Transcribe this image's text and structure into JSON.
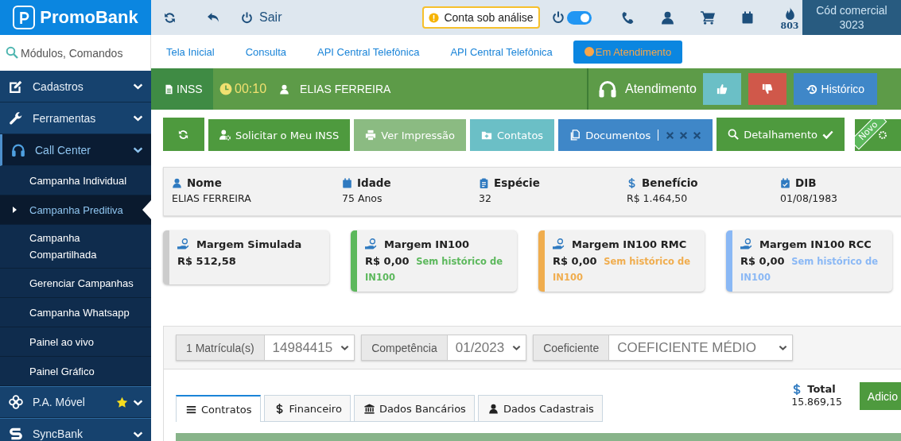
{
  "top_bar": {
    "logo": "PromoBank",
    "logout": "Sair",
    "status_badge": "Conta sob análise",
    "toggle": {
      "on": true
    },
    "points": "803",
    "commercial_code": {
      "label": "Cód comercial",
      "value": "3023"
    }
  },
  "sidebar": {
    "search": {
      "placeholder": "Módulos, Comandos"
    },
    "items": [
      {
        "label": "Cadastros",
        "kind": "edit",
        "expanded": false
      },
      {
        "label": "Ferramentas",
        "kind": "tools",
        "expanded": false
      },
      {
        "label": "Call Center",
        "kind": "headset",
        "expanded": true,
        "children": [
          {
            "label": "Campanha Individual",
            "selected": false
          },
          {
            "label": "Campanha Preditiva",
            "selected": true
          },
          {
            "label": "Campanha Compartilhada",
            "selected": false
          },
          {
            "label": "Gerenciar Campanhas",
            "selected": false
          },
          {
            "label": "Campanha Whatsapp",
            "selected": false
          },
          {
            "label": "Painel ao vivo",
            "selected": false
          },
          {
            "label": "Painel Gráfico",
            "selected": false
          }
        ]
      },
      {
        "label": "P.A. Móvel",
        "kind": "flower",
        "expanded": false,
        "favorite": true
      },
      {
        "label": "SyncBank",
        "kind": "sync",
        "expanded": false
      }
    ]
  },
  "nav_tabs": [
    {
      "label": "Tela Inicial",
      "selected": false
    },
    {
      "label": "Consulta",
      "selected": false
    },
    {
      "label": "API Central Telefônica",
      "selected": false
    },
    {
      "label": "API Central Telefônica",
      "selected": false
    },
    {
      "label": "Em Atendimento",
      "selected": true
    }
  ],
  "call_bar": {
    "product": "INSS",
    "timer": "00:10",
    "client": "ELIAS FERREIRA",
    "status": "Atendimento",
    "history": "Histórico"
  },
  "actions": [
    {
      "kind": "refresh"
    },
    {
      "kind": "request",
      "label": "Solicitar o Meu INSS"
    },
    {
      "kind": "print",
      "label": "Ver Impressão"
    },
    {
      "kind": "contacts",
      "label": "Contatos"
    },
    {
      "kind": "documents",
      "label": "Documentos"
    },
    {
      "kind": "details",
      "label": "Detalhamento"
    },
    {
      "kind": "new",
      "ribbon": "Novo"
    }
  ],
  "client": [
    {
      "kind": "person",
      "label": "Nome",
      "value": "ELIAS FERREIRA"
    },
    {
      "kind": "calendar",
      "label": "Idade",
      "value": "75 Anos"
    },
    {
      "kind": "clipboard",
      "label": "Espécie",
      "value": "32"
    },
    {
      "kind": "money",
      "label": "Benefício",
      "value": "R$ 1.464,50"
    },
    {
      "kind": "date",
      "label": "DIB",
      "value": "01/08/1983"
    }
  ],
  "margins": [
    {
      "title": "Margem Simulada",
      "value": "R$ 512,58",
      "color": "#cccccc"
    },
    {
      "title": "Margem IN100",
      "value": "R$ 0,00",
      "note": "Sem histórico de IN100",
      "color": "#5cb85c"
    },
    {
      "title": "Margem IN100 RMC",
      "value": "R$ 0,00",
      "note": "Sem histórico de IN100",
      "color": "#f0ad4e"
    },
    {
      "title": "Margem IN100 RCC",
      "value": "R$ 0,00",
      "note": "Sem histórico de IN100",
      "color": "#8ab8f5"
    }
  ],
  "filters": [
    {
      "label": "1 Matrícula(s)",
      "value": "14984415"
    },
    {
      "label": "Competência",
      "value": "01/2023"
    },
    {
      "label": "Coeficiente",
      "value": "COEFICIENTE MÉDIO"
    }
  ],
  "tabs": [
    {
      "kind": "list",
      "label": "Contratos",
      "selected": true
    },
    {
      "kind": "money",
      "label": "Financeiro",
      "selected": false
    },
    {
      "kind": "bank",
      "label": "Dados Bancários",
      "selected": false
    },
    {
      "kind": "user",
      "label": "Dados Cadastrais",
      "selected": false
    }
  ],
  "total": {
    "label": "Total",
    "value": "15.869,15"
  },
  "add_button": "Adicio"
}
